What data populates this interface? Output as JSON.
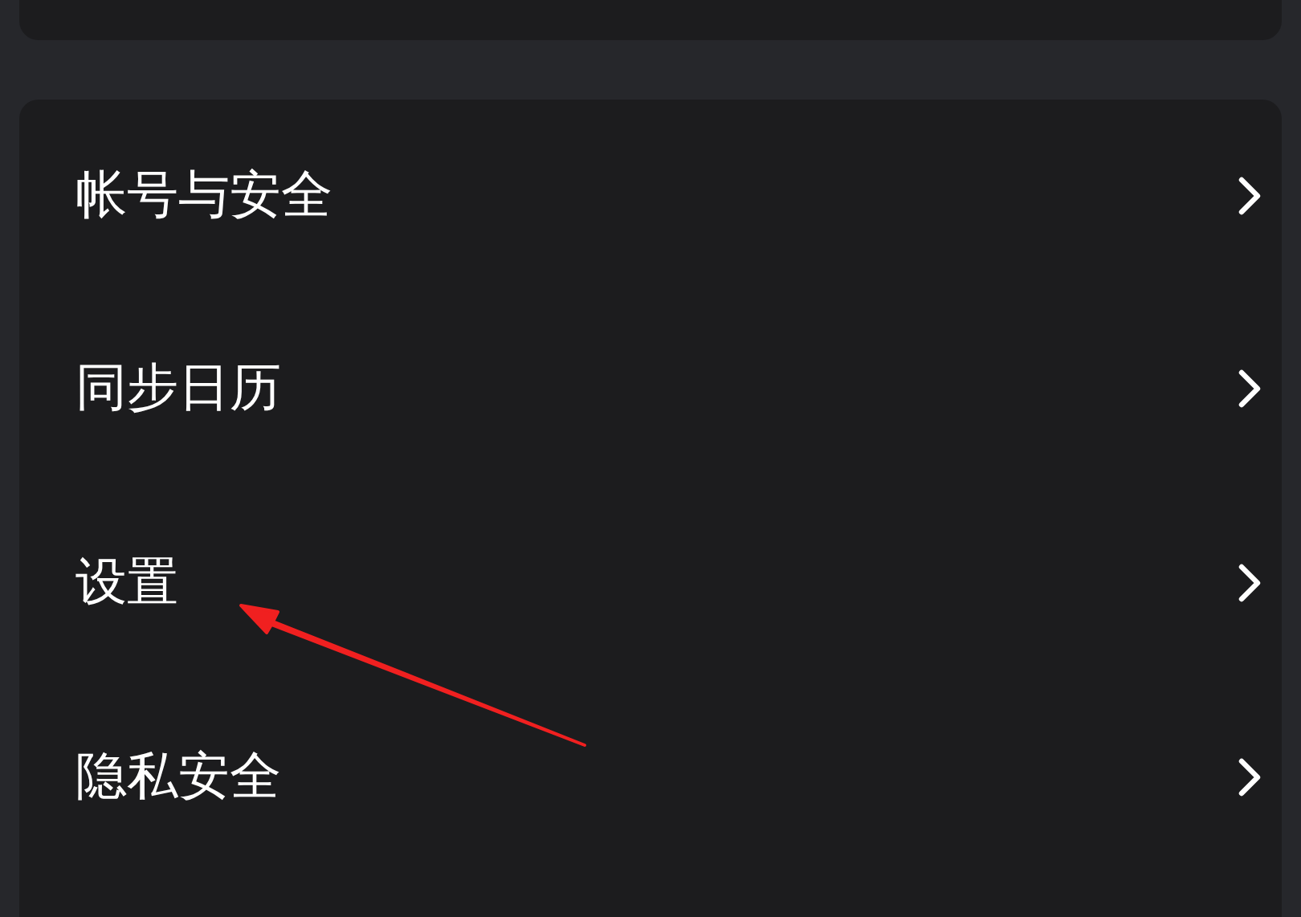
{
  "menu_items": [
    {
      "label": "帐号与安全"
    },
    {
      "label": "同步日历"
    },
    {
      "label": "设置"
    },
    {
      "label": "隐私安全"
    }
  ]
}
